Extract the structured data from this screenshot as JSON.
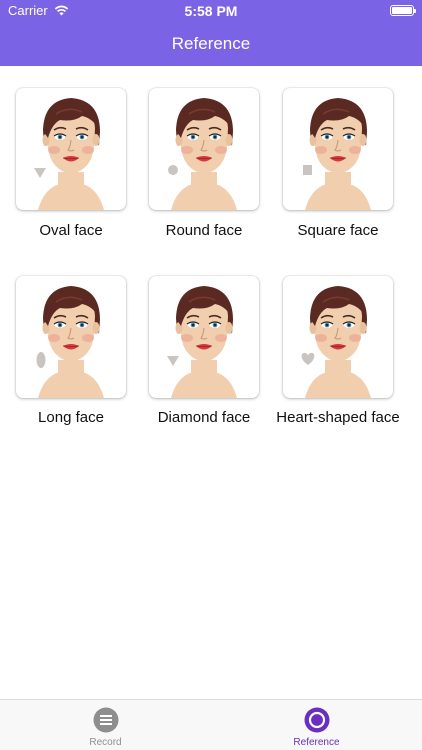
{
  "status_bar": {
    "carrier": "Carrier",
    "time": "5:58 PM"
  },
  "nav": {
    "title": "Reference"
  },
  "faces": [
    {
      "label": "Oval face",
      "shape_icon": "triangle-icon"
    },
    {
      "label": "Round face",
      "shape_icon": "circle-icon"
    },
    {
      "label": "Square face",
      "shape_icon": "square-icon"
    },
    {
      "label": "Long face",
      "shape_icon": "ellipse-icon"
    },
    {
      "label": "Diamond face",
      "shape_icon": "triangle-icon"
    },
    {
      "label": "Heart-shaped face",
      "shape_icon": "heart-icon"
    }
  ],
  "tabs": [
    {
      "label": "Record",
      "icon": "menu-lines-icon",
      "selected": false
    },
    {
      "label": "Reference",
      "icon": "ring-icon",
      "selected": true
    }
  ],
  "colors": {
    "accent": "#7b63e6",
    "tab_inactive": "#8e8e8e",
    "tab_active": "#6a2fc0",
    "hair": "#5a2a22",
    "skin": "#f1cfae",
    "shape_icon": "#c9c4c0"
  }
}
